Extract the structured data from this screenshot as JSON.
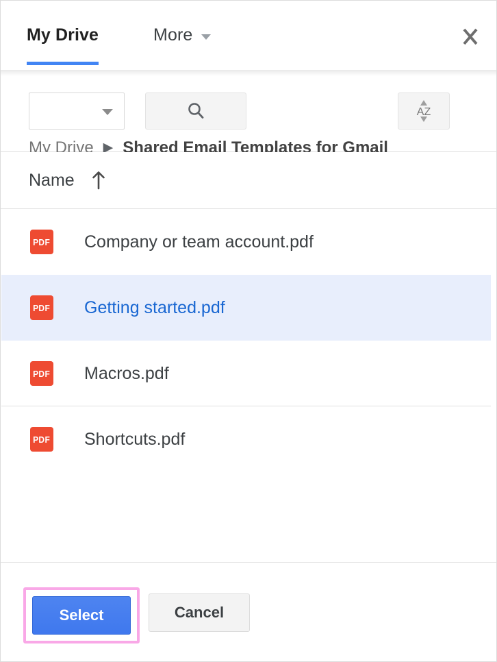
{
  "dialog": {
    "title": "My Drive",
    "close_label": "close-icon"
  },
  "tabs": [
    {
      "label": "My Drive",
      "active": true
    },
    {
      "label": "More",
      "active": false,
      "has_caret": true
    }
  ],
  "toolbar": {
    "filter_select_value": "",
    "filter_select_placeholder": "",
    "search_icon": "search-icon",
    "sort_icon": "sort-az-icon",
    "sort_icon_text": "AZ"
  },
  "breadcrumb": {
    "root": "My Drive",
    "separator": "▶",
    "current": "Shared Email Templates for Gmail"
  },
  "columns": {
    "name_header": "Name",
    "sort_direction": "ascending"
  },
  "files": [
    {
      "name": "Company or team account.pdf",
      "icon": "pdf-icon",
      "icon_text": "PDF",
      "selected": false,
      "divider": false
    },
    {
      "name": "Getting started.pdf",
      "icon": "pdf-icon",
      "icon_text": "PDF",
      "selected": true,
      "divider": false
    },
    {
      "name": "Macros.pdf",
      "icon": "pdf-icon",
      "icon_text": "PDF",
      "selected": false,
      "divider": true
    },
    {
      "name": "Shortcuts.pdf",
      "icon": "pdf-icon",
      "icon_text": "PDF",
      "selected": false,
      "divider": false
    }
  ],
  "footer": {
    "select_label": "Select",
    "cancel_label": "Cancel"
  },
  "colors": {
    "accent_blue": "#4285f4",
    "primary_button": "#3f78ee",
    "selected_row_bg": "#e8eefc",
    "selected_row_text": "#1967d2",
    "pdf_icon_red": "#ee4b32",
    "highlight_ring": "#f9a8e7"
  }
}
